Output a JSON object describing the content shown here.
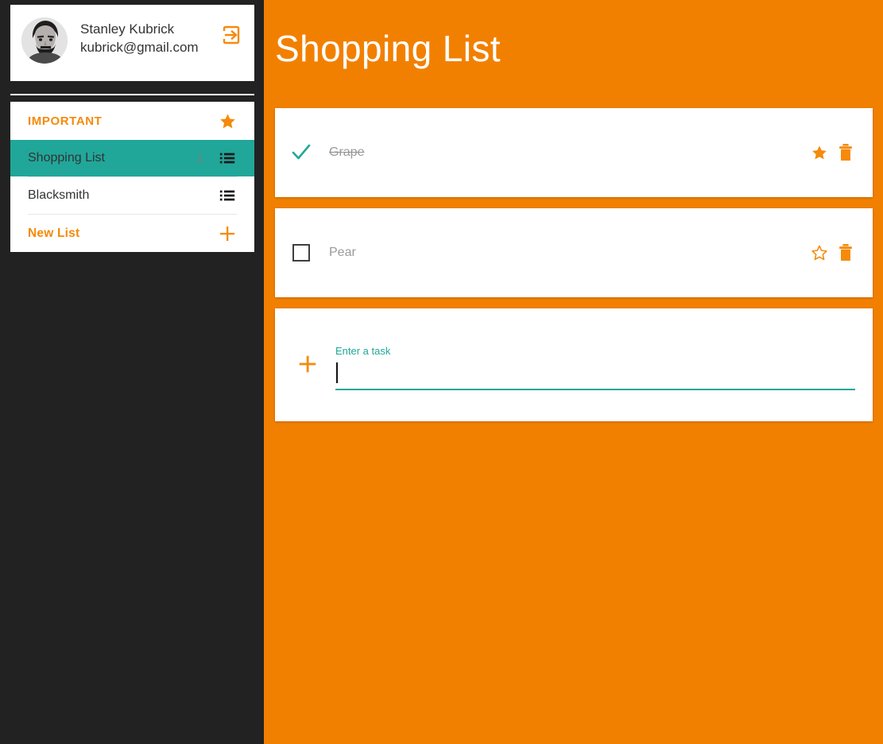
{
  "app": {
    "accent_orange": "#f28000",
    "accent_orange_light": "#f58a0b",
    "teal": "#20a79a",
    "sidebar_bg": "#222222",
    "card_bg": "#ffffff",
    "muted_text": "#9a9a9a"
  },
  "sidebar": {
    "user": {
      "name": "Stanley Kubrick",
      "email": "kubrick@gmail.com",
      "avatar_alt": "user-avatar-photo",
      "logout_icon": "logout-icon"
    },
    "lists": [
      {
        "label": "IMPORTANT",
        "icon": "star-filled-icon",
        "count": "",
        "selected": false,
        "type": "important"
      },
      {
        "label": "Shopping List",
        "icon": "list-icon",
        "count": "1",
        "selected": true,
        "type": "list"
      },
      {
        "label": "Blacksmith",
        "icon": "list-icon",
        "count": "",
        "selected": false,
        "type": "list"
      },
      {
        "label": "New List",
        "icon": "plus-icon",
        "count": "",
        "selected": false,
        "type": "new"
      }
    ]
  },
  "main": {
    "title": "Shopping List",
    "tasks": [
      {
        "label": "Grape",
        "done": true,
        "important": true,
        "check_icon": "check-icon",
        "star_icon": "star-filled-icon",
        "delete_icon": "trash-icon"
      },
      {
        "label": "Pear",
        "done": false,
        "important": false,
        "check_icon": "checkbox-empty-icon",
        "star_icon": "star-outline-icon",
        "delete_icon": "trash-icon"
      }
    ],
    "add_task": {
      "label": "Enter a task",
      "value": "",
      "placeholder": "",
      "add_icon": "plus-icon"
    }
  }
}
